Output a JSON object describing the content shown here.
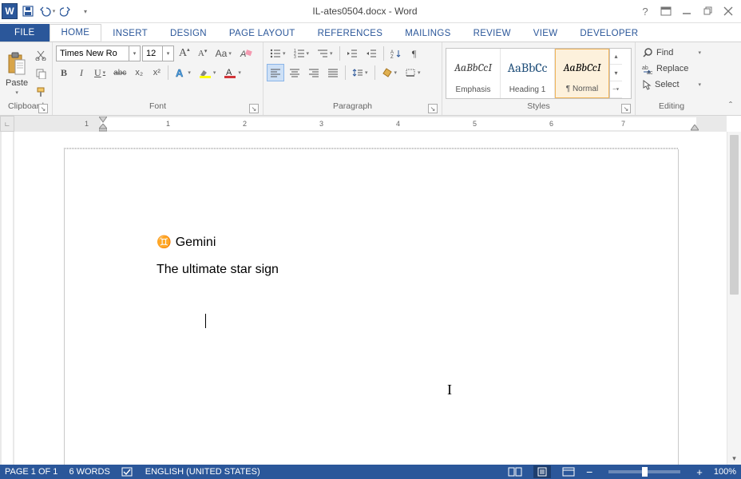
{
  "title": "IL-ates0504.docx - Word",
  "qat": {
    "save": "save-icon",
    "undo": "undo-icon",
    "redo": "redo-icon",
    "customize": "customize-icon"
  },
  "win": {
    "help": "?",
    "opts": "ribbon-display-options",
    "min": "minimize",
    "restore": "restore",
    "close": "close"
  },
  "tabs": {
    "file": "FILE",
    "home": "HOME",
    "insert": "INSERT",
    "design": "DESIGN",
    "pagelayout": "PAGE LAYOUT",
    "references": "REFERENCES",
    "mailings": "MAILINGS",
    "review": "REVIEW",
    "view": "VIEW",
    "developer": "DEVELOPER"
  },
  "ribbon": {
    "clipboard": {
      "label": "Clipboard",
      "paste": "Paste",
      "cut": "cut-icon",
      "copy": "copy-icon",
      "formatpainter": "format-painter-icon"
    },
    "font": {
      "label": "Font",
      "name": "Times New Ro",
      "size": "12",
      "grow": "A",
      "shrink": "A",
      "case": "Aa",
      "clear": "clear-format-icon",
      "bold": "B",
      "italic": "I",
      "underline": "U",
      "strike": "abc",
      "sub": "x₂",
      "sup": "x²",
      "effects": "text-effects-icon",
      "highlight": "highlight-icon",
      "color": "font-color-icon"
    },
    "paragraph": {
      "label": "Paragraph",
      "bullets": "bullets-icon",
      "numbering": "numbering-icon",
      "multilevel": "multilevel-icon",
      "dec": "decrease-indent-icon",
      "inc": "increase-indent-icon",
      "sort": "sort-icon",
      "marks": "¶",
      "al": "align-left",
      "ac": "align-center",
      "ar": "align-right",
      "aj": "justify",
      "ls": "line-spacing-icon",
      "shade": "shading-icon",
      "border": "borders-icon"
    },
    "styles": {
      "label": "Styles",
      "items": [
        {
          "preview": "AaBbCcI",
          "name": "Emphasis",
          "color": "#404040"
        },
        {
          "preview": "AaBbCc",
          "name": "Heading 1",
          "color": "#1f4e79"
        },
        {
          "preview": "AaBbCcI",
          "name": "¶ Normal",
          "color": "#000"
        }
      ]
    },
    "editing": {
      "label": "Editing",
      "find": "Find",
      "replace": "Replace",
      "select": "Select"
    }
  },
  "ruler": {
    "marks": [
      "1",
      "",
      "1",
      "2",
      "3",
      "4",
      "5",
      "6",
      "7"
    ]
  },
  "document": {
    "line1_symbol": "♊",
    "line1_text": "Gemini",
    "line2": "The ultimate star sign"
  },
  "status": {
    "page": "PAGE 1 OF 1",
    "words": "6 WORDS",
    "proof": "proofing-icon",
    "lang": "ENGLISH (UNITED STATES)",
    "zoom": "100%",
    "minus": "−",
    "plus": "+"
  }
}
